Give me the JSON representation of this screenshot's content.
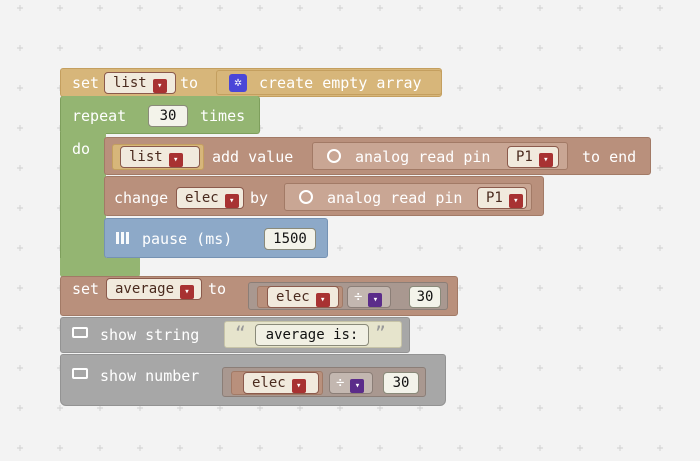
{
  "blocks": {
    "set_list": {
      "set": "set",
      "var": "list",
      "to": "to",
      "create": "create empty array"
    },
    "repeat": {
      "label": "repeat",
      "count": "30",
      "times": "times",
      "do": "do"
    },
    "add_value": {
      "var": "list",
      "label": "add value",
      "read": "analog read pin",
      "pin": "P1",
      "end": "to end"
    },
    "change": {
      "label": "change",
      "var": "elec",
      "by": "by",
      "read": "analog read pin",
      "pin": "P1"
    },
    "pause": {
      "label": "pause (ms)",
      "ms": "1500"
    },
    "set_avg": {
      "set": "set",
      "var": "average",
      "to": "to",
      "lhs": "elec",
      "op": "÷",
      "rhs": "30"
    },
    "show_string": {
      "label": "show string",
      "open_quote": "“",
      "text": "average is:",
      "close_quote": "”"
    },
    "show_number": {
      "label": "show number",
      "lhs": "elec",
      "op": "÷",
      "rhs": "30"
    }
  },
  "colors": {
    "variables": "#d7b67a",
    "loops": "#94b572",
    "pins": "#b9907c",
    "pins_inner": "#c9a694",
    "basic": "#8da9c8",
    "math": "#a99890",
    "math_inner": "#c3b7b0",
    "show": "#a7a7a7",
    "text": "#e6e4cc",
    "gear": "#4a46d8"
  },
  "icons": [
    "gear-icon",
    "radio-pin-icon",
    "grid-icon",
    "monitor-icon",
    "dropdown-arrow-icon"
  ]
}
